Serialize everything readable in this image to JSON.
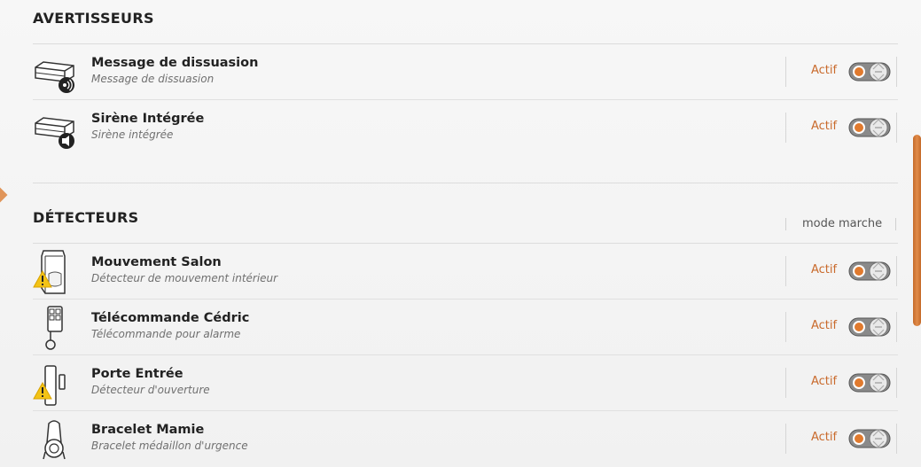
{
  "avertisseurs": {
    "title": "AVERTISSEURS",
    "items": [
      {
        "name": "Message de dissuasion",
        "subtitle": "Message de dissuasion",
        "status": "Actif",
        "icon": "speaker-sound-icon",
        "warning": false
      },
      {
        "name": "Sirène Intégrée",
        "subtitle": "Sirène intégrée",
        "status": "Actif",
        "icon": "siren-icon",
        "warning": false
      }
    ]
  },
  "detecteurs": {
    "title": "DÉTECTEURS",
    "column_header": "mode marche",
    "items": [
      {
        "name": "Mouvement Salon",
        "subtitle": "Détecteur de mouvement intérieur",
        "status": "Actif",
        "icon": "motion-detector-icon",
        "warning": true
      },
      {
        "name": "Télécommande Cédric",
        "subtitle": "Télécommande pour alarme",
        "status": "Actif",
        "icon": "remote-control-icon",
        "warning": false
      },
      {
        "name": "Porte Entrée",
        "subtitle": "Détecteur d'ouverture",
        "status": "Actif",
        "icon": "door-sensor-icon",
        "warning": true
      },
      {
        "name": "Bracelet Mamie",
        "subtitle": "Bracelet médaillon d'urgence",
        "status": "Actif",
        "icon": "emergency-bracelet-icon",
        "warning": false
      }
    ]
  },
  "colors": {
    "accent": "#c96a2c",
    "toggle_dot": "#e07a2e"
  }
}
